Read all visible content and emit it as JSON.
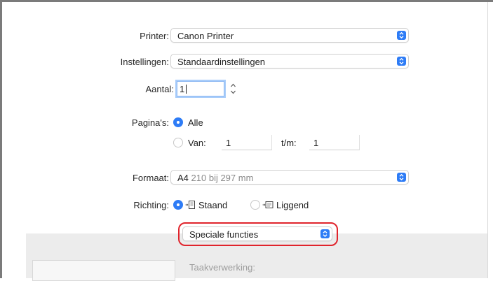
{
  "printer": {
    "label": "Printer:",
    "value": "Canon Printer"
  },
  "settings": {
    "label": "Instellingen:",
    "value": "Standaardinstellingen"
  },
  "copies": {
    "label": "Aantal:",
    "value": "1"
  },
  "pages": {
    "label": "Pagina's:",
    "all_label": "Alle",
    "all_selected": true,
    "from_label": "Van:",
    "from_value": "1",
    "to_label": "t/m:",
    "to_value": "1"
  },
  "paper_size": {
    "label": "Formaat:",
    "value_main": "A4",
    "value_detail": "210 bij 297 mm"
  },
  "orientation": {
    "label": "Richting:",
    "portrait_label": "Staand",
    "landscape_label": "Liggend",
    "selected": "portrait"
  },
  "section_menu": {
    "value": "Speciale functies"
  },
  "lower_panel": {
    "heading": "Taakverwerking:"
  },
  "colors": {
    "accent": "#2e7cf6",
    "highlight": "#e0242c"
  }
}
